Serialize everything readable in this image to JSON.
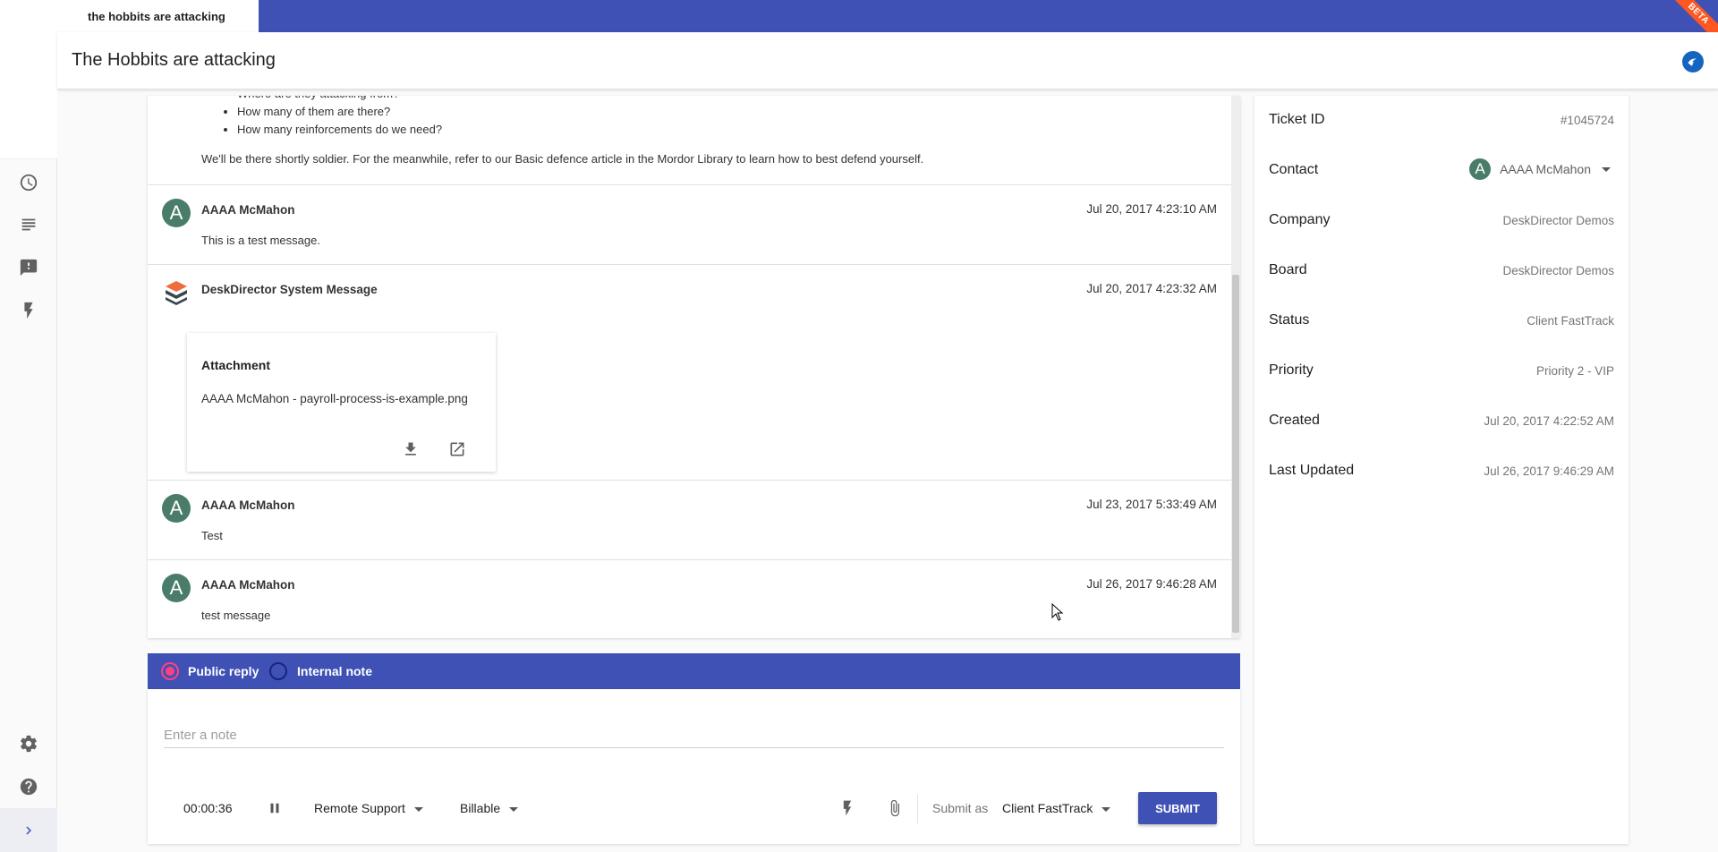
{
  "tab": {
    "label": "the hobbits are attacking"
  },
  "beta_label": "BETA",
  "page_title": "The Hobbits are attacking",
  "intro": {
    "bullets": [
      "Where are they attacking from?",
      "How many of them are there?",
      "How many reinforcements do we need?"
    ],
    "closing": "We'll be there shortly soldier. For the meanwhile, refer to our Basic defence article in the Mordor Library to learn how to best defend yourself."
  },
  "messages": [
    {
      "avatar_letter": "A",
      "author": "AAAA McMahon",
      "time": "Jul 20, 2017 4:23:10 AM",
      "body": "This is a test message."
    },
    {
      "author": "DeskDirector System Message",
      "time": "Jul 20, 2017 4:23:32 AM",
      "attachment": {
        "title": "Attachment",
        "filename": "AAAA McMahon - payroll-process-is-example.png"
      }
    },
    {
      "avatar_letter": "A",
      "author": "AAAA McMahon",
      "time": "Jul 23, 2017 5:33:49 AM",
      "body": "Test"
    },
    {
      "avatar_letter": "A",
      "author": "AAAA McMahon",
      "time": "Jul 26, 2017 9:46:28 AM",
      "body": "test message"
    }
  ],
  "reply": {
    "public_label": "Public reply",
    "internal_label": "Internal note",
    "selected": "public",
    "note_placeholder": "Enter a note",
    "timer": "00:00:36",
    "work_type": "Remote Support",
    "billing": "Billable",
    "submit_as_label": "Submit as",
    "submit_as_value": "Client FastTrack",
    "submit_label": "SUBMIT"
  },
  "details": {
    "ticket_id": {
      "label": "Ticket ID",
      "value": "#1045724"
    },
    "contact": {
      "label": "Contact",
      "avatar_letter": "A",
      "value": "AAAA McMahon"
    },
    "company": {
      "label": "Company",
      "value": "DeskDirector Demos"
    },
    "board": {
      "label": "Board",
      "value": "DeskDirector Demos"
    },
    "status": {
      "label": "Status",
      "value": "Client FastTrack"
    },
    "priority": {
      "label": "Priority",
      "value": "Priority 2 - VIP"
    },
    "created": {
      "label": "Created",
      "value": "Jul 20, 2017 4:22:52 AM"
    },
    "last_updated": {
      "label": "Last Updated",
      "value": "Jul 26, 2017 9:46:29 AM"
    }
  },
  "icons": {
    "rail": [
      "history-icon",
      "list-icon",
      "feedback-icon",
      "flash-icon",
      "settings-icon",
      "help-icon",
      "chevron-right-icon"
    ]
  },
  "colors": {
    "primary": "#3f51b5",
    "accent": "#ff4081",
    "beta": "#ff5722",
    "avatar": "#4a7c6a"
  }
}
